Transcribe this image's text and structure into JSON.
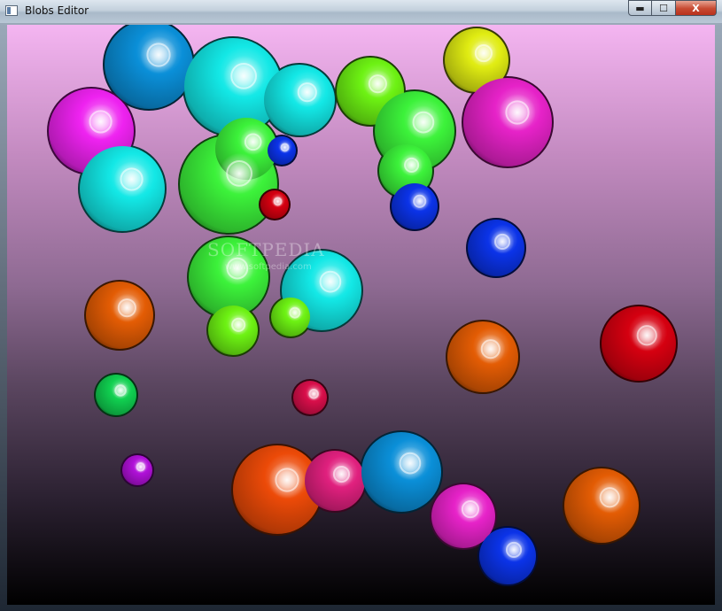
{
  "window": {
    "title": "Blobs Editor",
    "minimize_glyph": "▬",
    "maximize_glyph": "☐",
    "close_glyph": "X"
  },
  "watermark": {
    "text": "SOFTPEDIA",
    "url": "www.softpedia.com"
  },
  "blobs": [
    {
      "color": "#0a8fd8"
    },
    {
      "color": "#13e8e6"
    },
    {
      "color": "#3cf23a"
    },
    {
      "color": "#ee22f0"
    },
    {
      "color": "#6df213"
    },
    {
      "color": "#e0ec12"
    },
    {
      "color": "#e622c8"
    },
    {
      "color": "#0b33e8"
    },
    {
      "color": "#ec4a08"
    },
    {
      "color": "#e0207e"
    },
    {
      "color": "#d50010"
    },
    {
      "color": "#e35c04"
    },
    {
      "color": "#10d050"
    },
    {
      "color": "#b010d8"
    },
    {
      "color": "#d80e4a"
    }
  ]
}
